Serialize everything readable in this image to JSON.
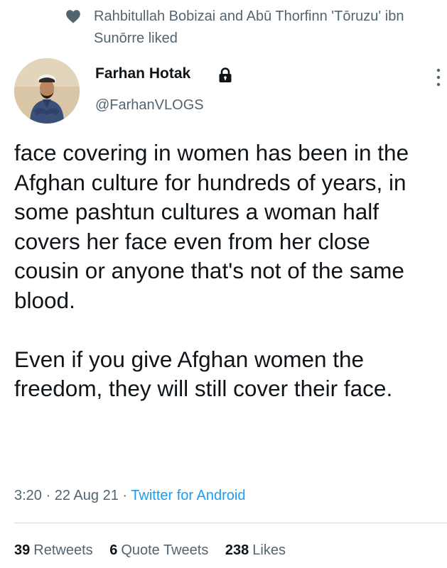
{
  "social_context": {
    "icon": "heart-icon",
    "text": "Rahbitullah Bobizai and Abū Thorfinn 'Tōruzu' ibn Sunōrre liked"
  },
  "author": {
    "display_name": "Farhan Hotak",
    "handle": "@FarhanVLOGS",
    "protected_icon": "lock-icon",
    "avatar": "avatar"
  },
  "tweet": {
    "text": "face covering in women has been in the Afghan culture for hundreds of years, in some pashtun cultures a woman half covers her face even from her close cousin or anyone that's not of the same blood.\n\nEven if you give Afghan women the freedom, they will still cover their face.",
    "time": "3:20",
    "date": "22 Aug 21",
    "separator": "·",
    "source": "Twitter for Android"
  },
  "stats": {
    "retweets_count": "39",
    "retweets_label": "Retweets",
    "quotes_count": "6",
    "quotes_label": "Quote Tweets",
    "likes_count": "238",
    "likes_label": "Likes"
  },
  "colors": {
    "text_primary": "#0f1419",
    "text_secondary": "#536471",
    "accent": "#1d9bf0",
    "divider": "#cfd9de"
  }
}
